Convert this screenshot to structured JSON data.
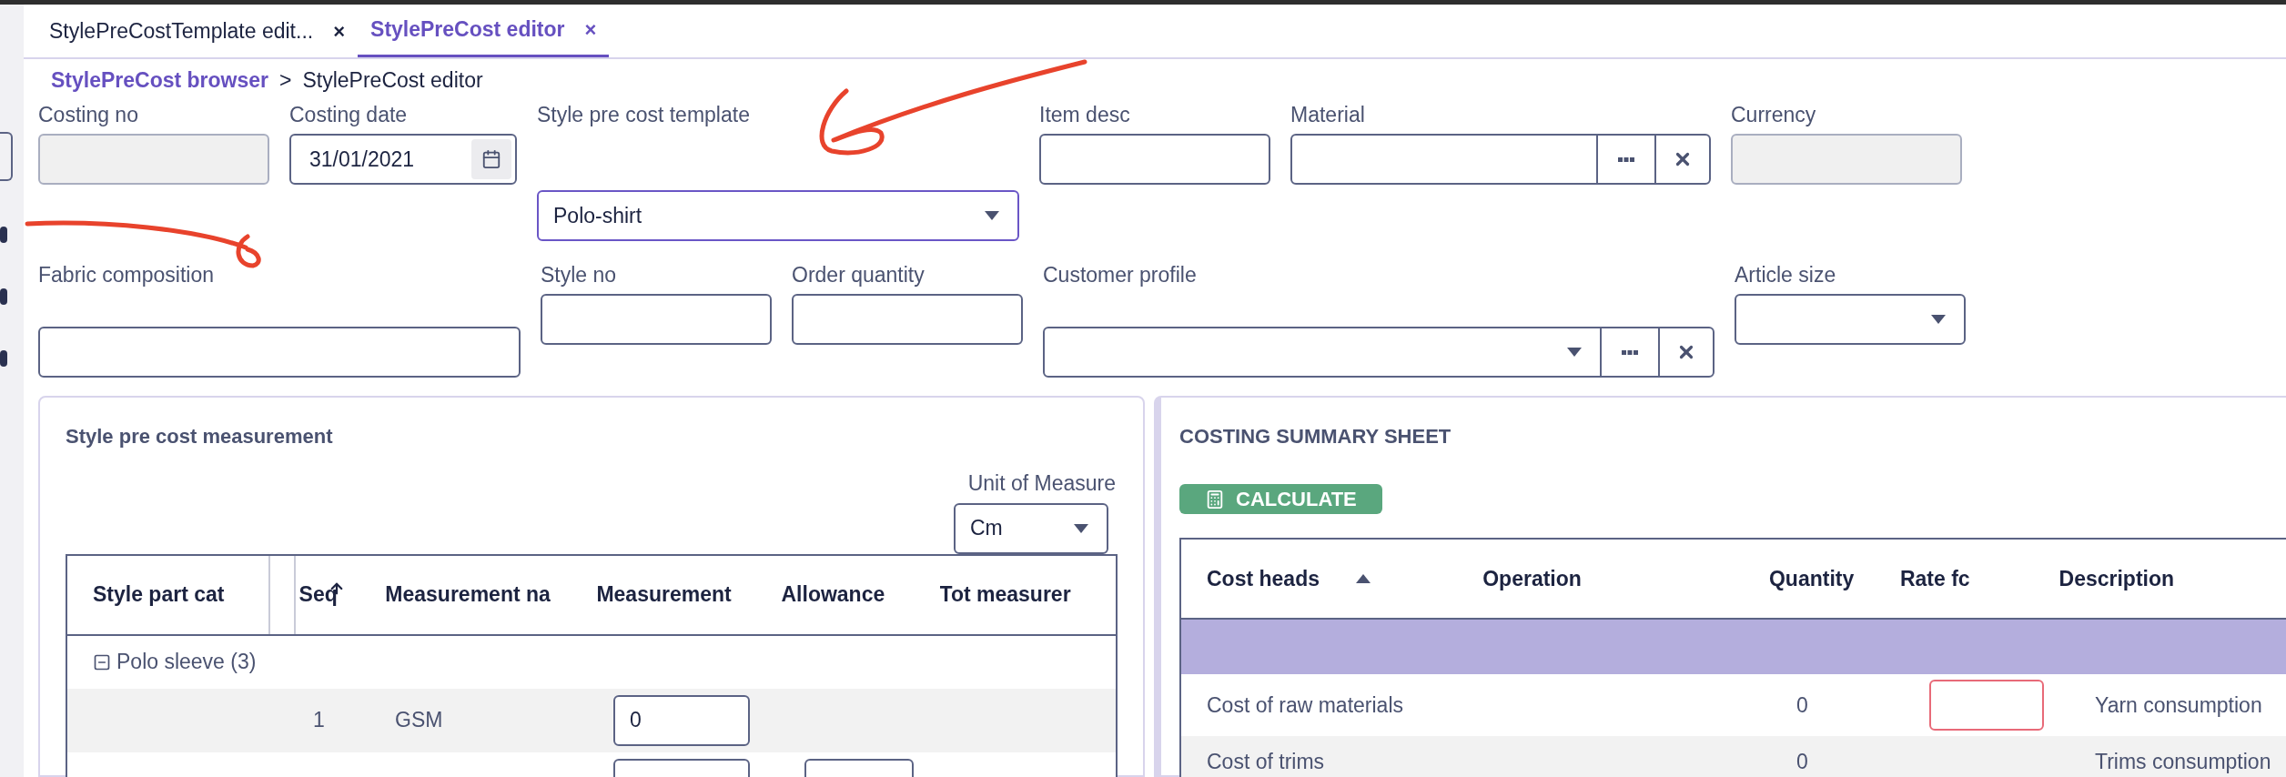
{
  "tabs": [
    {
      "label": "StylePreCostTemplate edit...",
      "close": "×",
      "selected": false
    },
    {
      "label": "StylePreCost editor",
      "close": "×",
      "selected": true
    }
  ],
  "breadcrumb": {
    "link": "StylePreCost browser",
    "separator": ">",
    "current": "StylePreCost editor"
  },
  "form": {
    "fields": [
      {
        "label": "Costing no",
        "kind": "text",
        "disabled": true
      },
      {
        "label": "Costing date",
        "kind": "date",
        "value": "31/01/2021",
        "disabled": false
      },
      {
        "label": "Style pre cost template",
        "kind": "select",
        "value": "Polo-shirt",
        "focused": true,
        "disabled": false
      },
      {
        "label": "Item desc",
        "kind": "text",
        "disabled": false
      },
      {
        "label": "Material",
        "kind": "lookup",
        "disabled": false
      },
      {
        "label": "Currency",
        "kind": "text",
        "disabled": true
      },
      {
        "label": "Fabric composition",
        "kind": "text",
        "disabled": false
      },
      {
        "label": "Style no",
        "kind": "text",
        "disabled": false
      },
      {
        "label": "Order quantity",
        "kind": "text",
        "disabled": false
      },
      {
        "label": "Customer profile",
        "kind": "lookup_select",
        "disabled": false
      },
      {
        "label": "Article size",
        "kind": "select",
        "focused": false,
        "disabled": false
      }
    ]
  },
  "measurement": {
    "title": "Style pre cost measurement",
    "unit_label": "Unit of Measure",
    "unit_value": "Cm",
    "columns": [
      {
        "label": "Style part cat",
        "sorted": false
      },
      {
        "label": "Seq",
        "sorted": true
      },
      {
        "label": "Measurement na",
        "sorted": false
      },
      {
        "label": "Measurement",
        "sorted": false
      },
      {
        "label": "Allowance",
        "sorted": false
      },
      {
        "label": "Tot measurer",
        "sorted": false
      }
    ],
    "group": {
      "label": "Polo sleeve (3)",
      "expanded": true
    },
    "rows": [
      {
        "seq": "1",
        "name": "GSM",
        "measurement": "0",
        "allowance_field": false
      },
      {
        "allowance_field": true
      }
    ]
  },
  "summary": {
    "title": "COSTING SUMMARY SHEET",
    "button": "CALCULATE",
    "columns": [
      {
        "label": "Cost heads",
        "sorted": true
      },
      {
        "label": "Operation",
        "sorted": false
      },
      {
        "label": "Quantity",
        "sorted": false
      },
      {
        "label": "Rate fc",
        "sorted": false
      },
      {
        "label": "Description",
        "sorted": false
      }
    ],
    "rows": [
      {
        "kind": "blank",
        "selected": true
      },
      {
        "kind": "data",
        "selected": false,
        "cost_head": "Cost of raw materials",
        "quantity": "0",
        "rate_field": true,
        "rate_invalid": true,
        "description": "Yarn consumption"
      },
      {
        "kind": "data",
        "selected": false,
        "cost_head": "Cost of trims",
        "quantity": "0",
        "rate_field": false,
        "description": "Trims consumption"
      }
    ]
  }
}
